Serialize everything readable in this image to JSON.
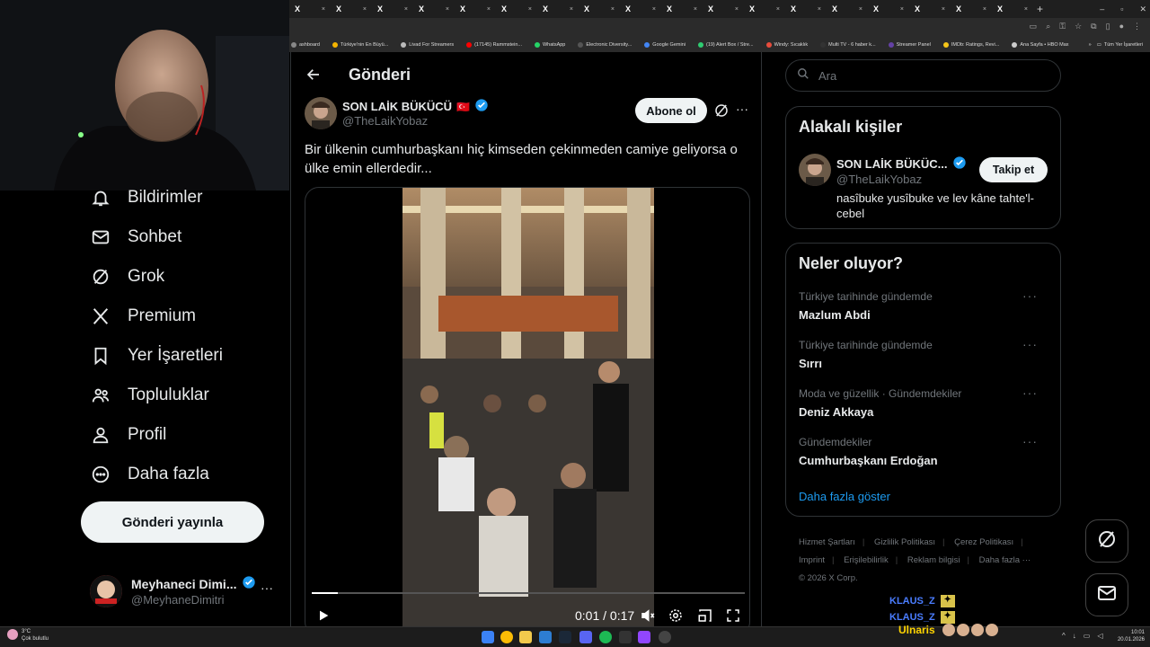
{
  "browser": {
    "tab_label": "",
    "tab_count": 18,
    "bookmarks": [
      {
        "label": "ashboard",
        "color": "#888"
      },
      {
        "label": "Türkiye'nin En Büyü...",
        "color": "#f4b400"
      },
      {
        "label": "Livad For Streamers",
        "color": "#bbb"
      },
      {
        "label": "(17145) Rammstein...",
        "color": "#ff0000"
      },
      {
        "label": "WhatsApp",
        "color": "#25d366"
      },
      {
        "label": "Electronic Diversity...",
        "color": "#555"
      },
      {
        "label": "Google Gemini",
        "color": "#4285f4"
      },
      {
        "label": "(19) Alert Box / Stre...",
        "color": "#2ecc71"
      },
      {
        "label": "Windy: Sıcaklık",
        "color": "#e74c3c"
      },
      {
        "label": "Multi TV - 6 haber k...",
        "color": "#333"
      },
      {
        "label": "Streamer Panel",
        "color": "#6441a5"
      },
      {
        "label": "IMDb: Ratings, Revi...",
        "color": "#f5c518"
      },
      {
        "label": "Ana Sayfa • HBO Max",
        "color": "#ccc"
      }
    ],
    "bookmarks_more": "»",
    "all_bookmarks": "Tüm Yer İşaretleri"
  },
  "webcam": {
    "alt": "Yayıncı kamera görüntüsü"
  },
  "nav": {
    "items": [
      {
        "label": "Bildirimler",
        "icon": "bell-icon"
      },
      {
        "label": "Sohbet",
        "icon": "mail-icon"
      },
      {
        "label": "Grok",
        "icon": "grok-icon"
      },
      {
        "label": "Premium",
        "icon": "x-logo-icon"
      },
      {
        "label": "Yer İşaretleri",
        "icon": "bookmark-icon"
      },
      {
        "label": "Topluluklar",
        "icon": "communities-icon"
      },
      {
        "label": "Profil",
        "icon": "profile-icon"
      },
      {
        "label": "Daha fazla",
        "icon": "more-circle-icon"
      }
    ],
    "post_button": "Gönderi yayınla",
    "account": {
      "name": "Meyhaneci Dimi...",
      "handle": "@MeyhaneDimitri",
      "more": "···"
    }
  },
  "main": {
    "header_title": "Gönderi",
    "author": {
      "name": "SON LAİK BÜKÜCÜ",
      "flag": "🇹🇷",
      "handle": "@TheLaikYobaz"
    },
    "subscribe_label": "Abone ol",
    "more": "···",
    "text": "Bir ülkenin cumhurbaşkanı hiç kimseden çekinmeden camiye geliyorsa o ülke emin ellerdedir...",
    "video": {
      "time": "0:01 / 0:17",
      "progress": 0.06
    }
  },
  "right": {
    "search_placeholder": "Ara",
    "related": {
      "title": "Alakalı kişiler",
      "name": "SON LAİK BÜKÜC...",
      "handle": "@TheLaikYobaz",
      "bio": "nasîbuke yusîbuke ve lev kâne tahte'l-cebel",
      "follow": "Takip et"
    },
    "trends": {
      "title": "Neler oluyor?",
      "items": [
        {
          "sub": "Türkiye tarihinde gündemde",
          "title": "Mazlum Abdi"
        },
        {
          "sub": "Türkiye tarihinde gündemde",
          "title": "Sırrı"
        },
        {
          "sub": "Moda ve güzellik · Gündemdekiler",
          "title": "Deniz Akkaya"
        },
        {
          "sub": "Gündemdekiler",
          "title": "Cumhurbaşkanı Erdoğan"
        }
      ],
      "show_more": "Daha fazla göster",
      "more": "···"
    },
    "footer": [
      "Hizmet Şartları",
      "Gizlilik Politikası",
      "Çerez Politikası",
      "Imprint",
      "Erişilebilirlik",
      "Reklam bilgisi",
      "Daha fazla ···",
      "© 2026 X Corp."
    ]
  },
  "chat": {
    "line1": "KLAUS_Z",
    "line2": "KLAUS_Z",
    "line3": "Ulnaris"
  },
  "taskbar": {
    "weather_temp": "3°C",
    "weather_desc": "Çok bulutlu",
    "time": "10:01",
    "date": "20.01.2026"
  }
}
